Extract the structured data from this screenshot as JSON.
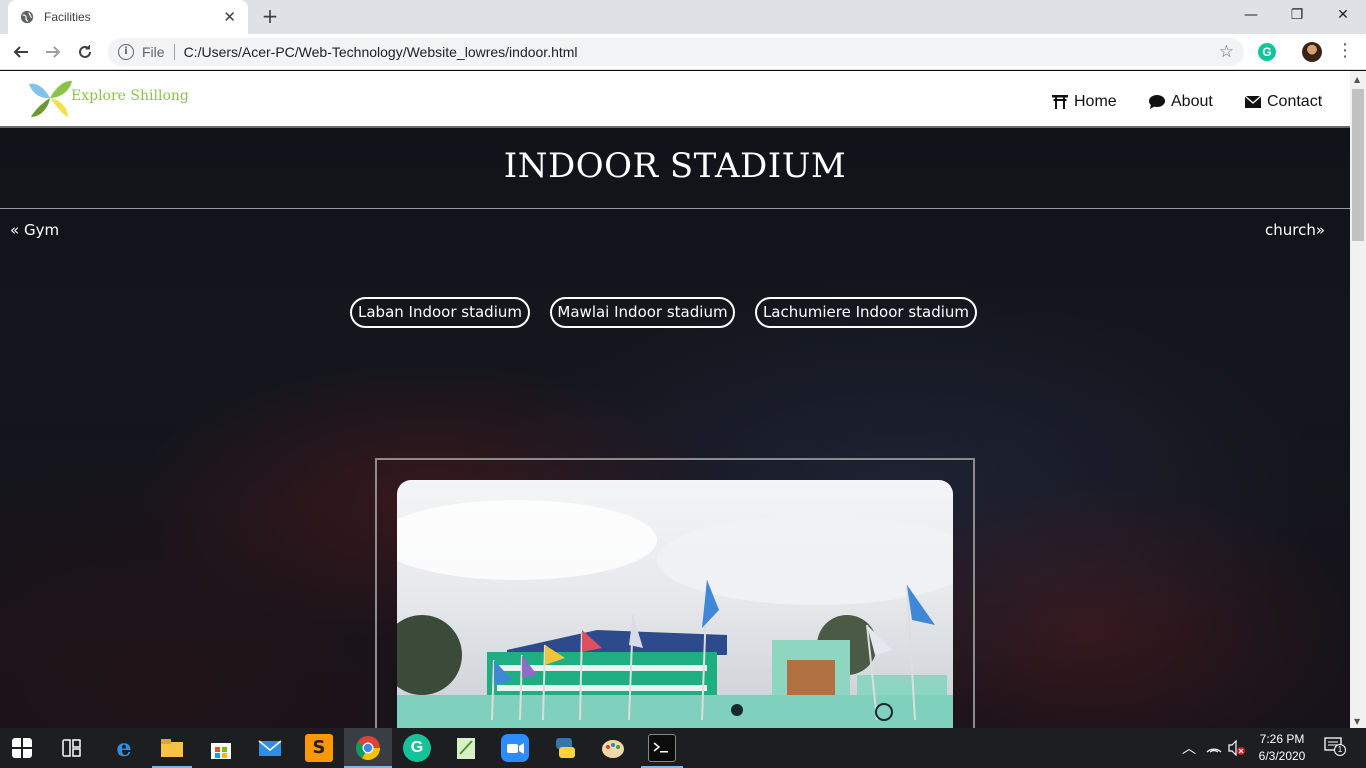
{
  "browser": {
    "tab_title": "Facilities",
    "tab_close": "✕",
    "new_tab": "+",
    "scheme": "File",
    "url": "C:/Users/Acer-PC/Web-Technology/Website_lowres/indoor.html",
    "win_minimize": "—",
    "win_restore": "❐",
    "win_close": "✕"
  },
  "site": {
    "logo_text": "Explore Shillong",
    "nav": [
      {
        "label": "Home",
        "icon": "torii-gate-icon"
      },
      {
        "label": "About",
        "icon": "speech-bubble-icon"
      },
      {
        "label": "Contact",
        "icon": "envelope-icon"
      }
    ]
  },
  "page": {
    "title": "INDOOR STADIUM",
    "prev_label": "Gym",
    "next_label": "church",
    "stadiums": [
      "Laban Indoor stadium",
      "Mawlai Indoor stadium",
      "Lachumiere Indoor stadium"
    ]
  },
  "taskbar": {
    "time": "7:26 PM",
    "date": "6/3/2020",
    "notification_count": "1"
  },
  "colors": {
    "logo_text": "#8bc34a",
    "page_bg": "#111218",
    "taskbar": "#1c1e22"
  }
}
